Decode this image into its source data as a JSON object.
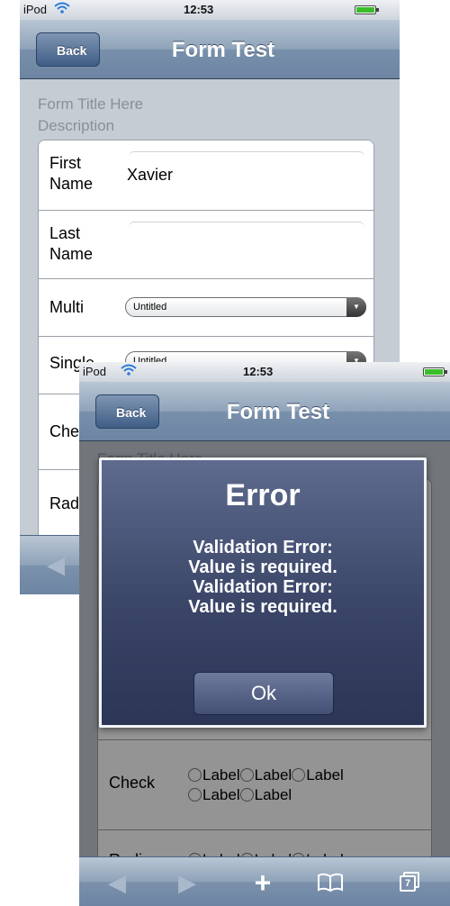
{
  "back_screen": {
    "status": {
      "carrier": "iPod",
      "time": "12:53"
    },
    "nav": {
      "back_label": "Back",
      "title": "Form Test"
    },
    "form": {
      "title": "Form Title Here",
      "description": "Description",
      "first_name_label_1": "First",
      "first_name_label_2": "Name",
      "first_name_value": "Xavier",
      "last_name_label_1": "Last",
      "last_name_label_2": "Name",
      "multi_label": "Multi",
      "multi_value": "Untitled",
      "single_label": "Single",
      "single_value": "Untitled",
      "check_label": "Check",
      "radio_label": "Radio"
    }
  },
  "front_screen": {
    "status": {
      "carrier": "iPod",
      "time": "12:53"
    },
    "nav": {
      "back_label": "Back",
      "title": "Form Test"
    },
    "form_title_partial": "Form Title Here",
    "dialog": {
      "title": "Error",
      "message_1": "Validation Error:",
      "message_2": "Value is required.",
      "message_3": "Validation Error:",
      "message_4": "Value is required.",
      "ok_label": "Ok"
    },
    "check_row": {
      "label": "Check",
      "options": [
        "Label",
        "Label",
        "Label",
        "Label",
        "Label"
      ]
    },
    "radio_row": {
      "label": "Radio",
      "options": [
        "Label",
        "Label",
        "Label"
      ]
    },
    "toolbar": {
      "back_icon": "back-arrow-icon",
      "forward_icon": "forward-arrow-icon",
      "add_icon": "plus-icon",
      "bookmarks_icon": "bookmarks-icon",
      "pages_icon": "pages-icon",
      "pages_count": "7"
    }
  }
}
